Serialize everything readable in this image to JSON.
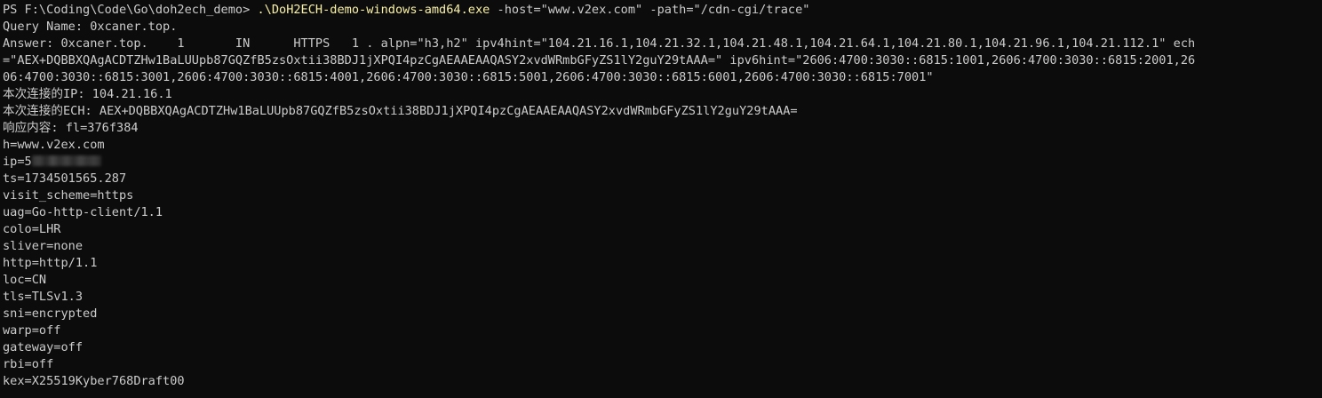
{
  "command": {
    "prompt": "PS F:\\Coding\\Code\\Go\\doh2ech_demo> ",
    "exe": ".\\DoH2ECH-demo-windows-amd64.exe",
    "args": " -host=\"www.v2ex.com\" -path=\"/cdn-cgi/trace\""
  },
  "output": {
    "query_name": "Query Name: 0xcaner.top.",
    "answer_1": "Answer: 0xcaner.top.    1       IN      HTTPS   1 . alpn=\"h3,h2\" ipv4hint=\"104.21.16.1,104.21.32.1,104.21.48.1,104.21.64.1,104.21.80.1,104.21.96.1,104.21.112.1\" ech",
    "answer_2": "=\"AEX+DQBBXQAgACDTZHw1BaLUUpb87GQZfB5zsOxtii38BDJ1jXPQI4pzCgAEAAEAAQASY2xvdWRmbGFyZS1lY2guY29tAAA=\" ipv6hint=\"2606:4700:3030::6815:1001,2606:4700:3030::6815:2001,26",
    "answer_3": "06:4700:3030::6815:3001,2606:4700:3030::6815:4001,2606:4700:3030::6815:5001,2606:4700:3030::6815:6001,2606:4700:3030::6815:7001\"",
    "conn_ip": "本次连接的IP: 104.21.16.1",
    "conn_ech": "本次连接的ECH: AEX+DQBBXQAgACDTZHw1BaLUUpb87GQZfB5zsOxtii38BDJ1jXPQI4pzCgAEAAEAAQASY2xvdWRmbGFyZS1lY2guY29tAAA=",
    "response_fl": "响应内容: fl=376f384",
    "h": "h=www.v2ex.com",
    "ip_prefix": "ip=5",
    "ts": "ts=1734501565.287",
    "visit_scheme": "visit_scheme=https",
    "uag": "uag=Go-http-client/1.1",
    "colo": "colo=LHR",
    "sliver": "sliver=none",
    "http": "http=http/1.1",
    "loc": "loc=CN",
    "tls": "tls=TLSv1.3",
    "sni": "sni=encrypted",
    "warp": "warp=off",
    "gateway": "gateway=off",
    "rbi": "rbi=off",
    "kex": "kex=X25519Kyber768Draft00"
  }
}
